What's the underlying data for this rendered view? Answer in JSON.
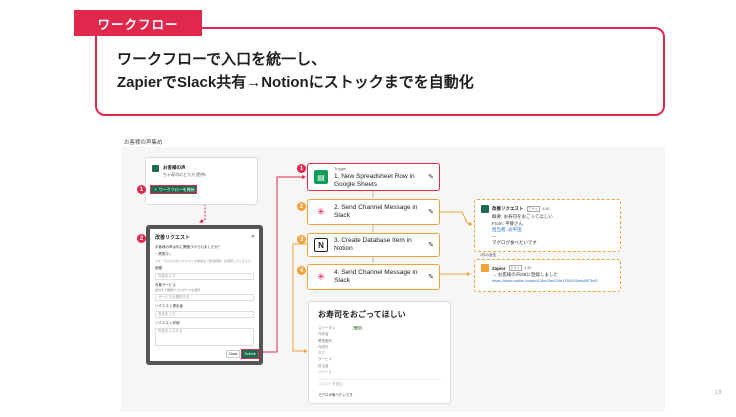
{
  "tag": "ワークフロー",
  "headline": {
    "line1": "ワークフローで入口を統一し、",
    "line2": "ZapierでSlack共有→Notionにストックまでを自動化"
  },
  "canvas_label": "お客様の声集め",
  "page_number": "19",
  "slack_post": {
    "title": "お客様の声",
    "subtitle": "ちゃ寿司のとり方 提供!!",
    "button": "ワークフローを開始"
  },
  "form": {
    "title": "改善リクエスト",
    "question": "お客様の声は何に関連づけられましたか？",
    "option": "関連なし",
    "hint": "フォーラムからのリクエストの場合は「該当箇所」を選択してください",
    "label1": "価格",
    "placeholder1": "内容を入力",
    "label2": "対象サービス",
    "hint2": "該当する機能やプロダクトを選択",
    "placeholder2": "サービスを選択する",
    "label3": "リクエスト提出者",
    "placeholder3": "名前を入力",
    "label4": "リクエスト詳細",
    "placeholder4": "内容を入力する",
    "cancel": "Close",
    "submit": "Submit"
  },
  "steps": [
    {
      "badge": "1",
      "pre": "Trigger",
      "text": "1. New Spreadsheet Row in Google Sheets"
    },
    {
      "badge": "2",
      "pre": "",
      "text": "2. Send Channel Message in Slack"
    },
    {
      "badge": "3",
      "pre": "",
      "text": "3. Create Database Item in Notion"
    },
    {
      "badge": "4",
      "pre": "",
      "text": "4. Send Channel Message in Slack"
    }
  ],
  "slack_msg1": {
    "title": "改善リクエスト",
    "app": "アプリ",
    "time": "4:30",
    "line1": "概要: お寿司をおごってほしい",
    "line2": "From: 平静さん",
    "line3": "担当者: @平田",
    "line4": "—",
    "line5": "マグロが食べたいです"
  },
  "slack_msg2": {
    "reply_label": "1件の返信",
    "title": "Zapier",
    "app": "アプリ",
    "time": "4:31",
    "line1": "→ お客様の声DBに登録しました",
    "url": "https://www.notion.so/bed12be00e024e1760025efcAff73cf0"
  },
  "notion": {
    "title": "お寿司をおごってほしい",
    "rows": [
      "ステータス",
      "作成者",
      "関連箇所",
      "作成日",
      "タグ",
      "サービス",
      "担当者",
      "リリース"
    ],
    "status": "受付",
    "comment": "コメントを追加",
    "body": "マグロが食べたいです"
  },
  "colors": {
    "accent": "#e0284d",
    "orange": "#f2a23a",
    "slack_green": "#1e6b52"
  }
}
